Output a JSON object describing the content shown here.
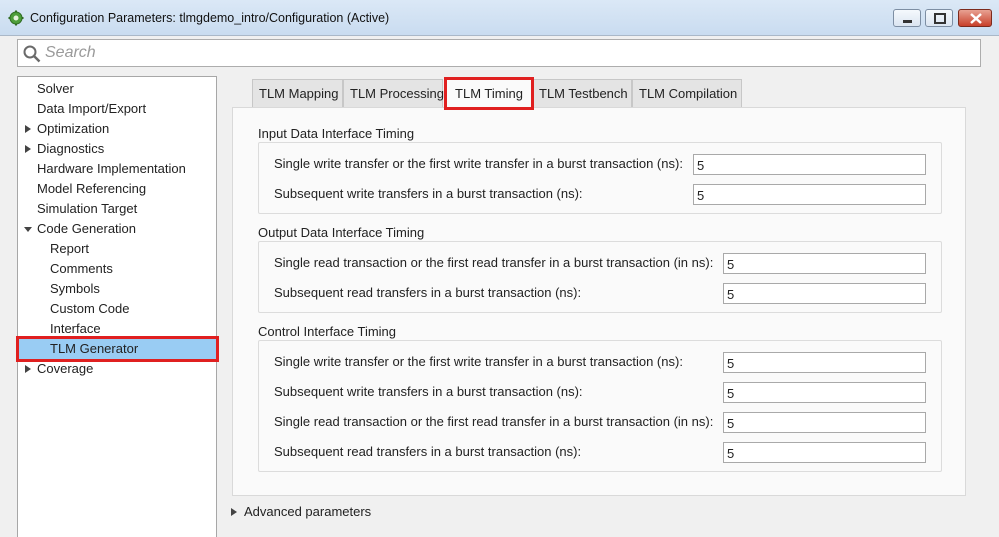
{
  "window": {
    "title": "Configuration Parameters: tlmgdemo_intro/Configuration (Active)",
    "icon": "gear-icon"
  },
  "search": {
    "placeholder": "Search"
  },
  "sidebar": {
    "items": [
      {
        "label": "Solver",
        "level": 0,
        "expandable": false
      },
      {
        "label": "Data Import/Export",
        "level": 0,
        "expandable": false
      },
      {
        "label": "Optimization",
        "level": 0,
        "expandable": true,
        "expanded": false
      },
      {
        "label": "Diagnostics",
        "level": 0,
        "expandable": true,
        "expanded": false
      },
      {
        "label": "Hardware Implementation",
        "level": 0,
        "expandable": false
      },
      {
        "label": "Model Referencing",
        "level": 0,
        "expandable": false
      },
      {
        "label": "Simulation Target",
        "level": 0,
        "expandable": false
      },
      {
        "label": "Code Generation",
        "level": 0,
        "expandable": true,
        "expanded": true
      },
      {
        "label": "Report",
        "level": 1,
        "expandable": false
      },
      {
        "label": "Comments",
        "level": 1,
        "expandable": false
      },
      {
        "label": "Symbols",
        "level": 1,
        "expandable": false
      },
      {
        "label": "Custom Code",
        "level": 1,
        "expandable": false
      },
      {
        "label": "Interface",
        "level": 1,
        "expandable": false
      },
      {
        "label": "TLM Generator",
        "level": 1,
        "expandable": false,
        "selected": true
      },
      {
        "label": "Coverage",
        "level": 0,
        "expandable": true,
        "expanded": false
      }
    ]
  },
  "tabs": [
    {
      "label": "TLM Mapping",
      "active": false
    },
    {
      "label": "TLM Processing",
      "active": false
    },
    {
      "label": "TLM Timing",
      "active": true
    },
    {
      "label": "TLM Testbench",
      "active": false
    },
    {
      "label": "TLM Compilation",
      "active": false
    }
  ],
  "groups": [
    {
      "title": "Input Data Interface Timing",
      "fields": [
        {
          "label": "Single write transfer or the first write transfer in a burst transaction (ns):",
          "value": "5"
        },
        {
          "label": "Subsequent write transfers in a burst transaction (ns):",
          "value": "5"
        }
      ]
    },
    {
      "title": "Output Data Interface Timing",
      "fields": [
        {
          "label": "Single read transaction or the first read transfer in a burst transaction (in ns):",
          "value": "5"
        },
        {
          "label": "Subsequent read transfers in a burst transaction (ns):",
          "value": "5"
        }
      ]
    },
    {
      "title": "Control Interface Timing",
      "fields": [
        {
          "label": "Single write transfer or the first write transfer in a burst transaction (ns):",
          "value": "5"
        },
        {
          "label": "Subsequent write transfers in a burst transaction (ns):",
          "value": "5"
        },
        {
          "label": "Single read transaction or the first read transfer in a burst transaction (in ns):",
          "value": "5"
        },
        {
          "label": "Subsequent read transfers in a burst transaction (ns):",
          "value": "5"
        }
      ]
    }
  ],
  "advanced": {
    "label": "Advanced parameters"
  },
  "colors": {
    "highlight": "#e02020",
    "selection": "#99ccf3"
  }
}
